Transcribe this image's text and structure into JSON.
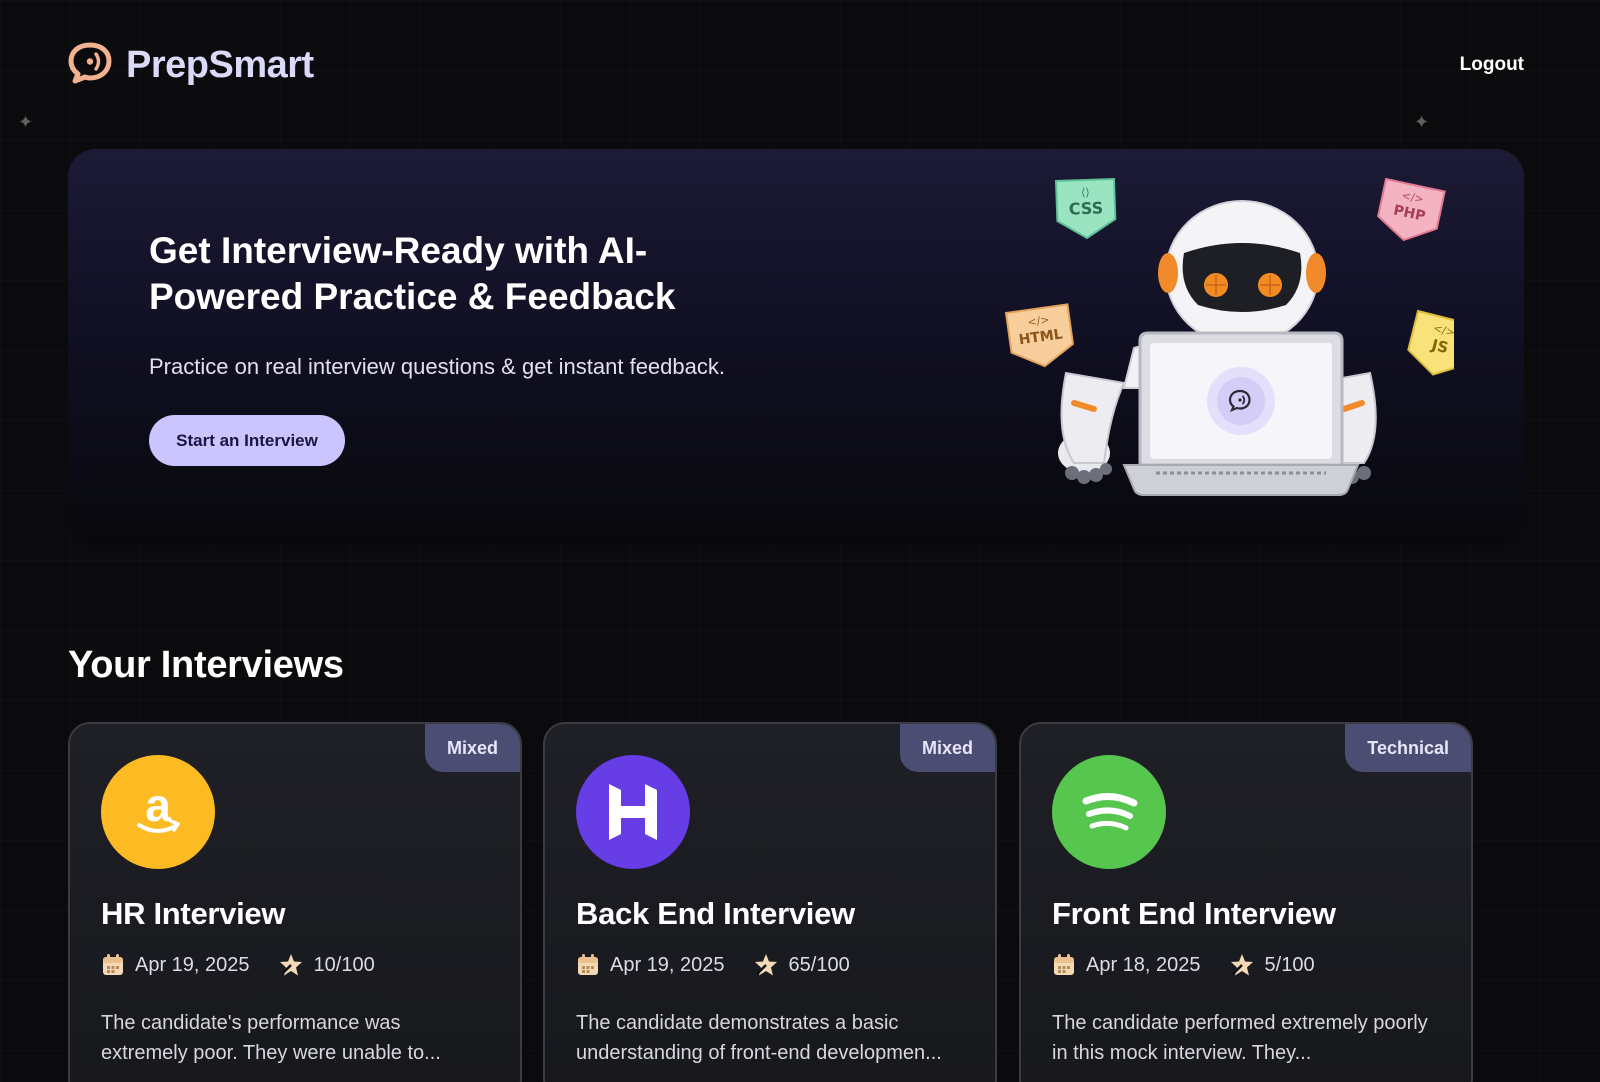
{
  "header": {
    "brand": "PrepSmart",
    "logout_label": "Logout"
  },
  "hero": {
    "title": "Get Interview-Ready with AI-Powered Practice & Feedback",
    "subtitle": "Practice on real interview questions & get instant feedback.",
    "cta_label": "Start an Interview",
    "stickers": [
      "CSS",
      "PHP",
      "HTML",
      "JS"
    ]
  },
  "interviews": {
    "title": "Your Interviews",
    "cards": [
      {
        "role": "HR Interview",
        "type": "Mixed",
        "date": "Apr 19, 2025",
        "score": "10/100",
        "summary": "The candidate's performance was extremely poor. They were unable to...",
        "logo": "amazon-logo",
        "logo_color": "#fcbb22"
      },
      {
        "role": "Back End Interview",
        "type": "Mixed",
        "date": "Apr 19, 2025",
        "score": "65/100",
        "summary": "The candidate demonstrates a basic understanding of front-end developmen...",
        "logo": "hostinger-logo",
        "logo_color": "#673de6"
      },
      {
        "role": "Front End Interview",
        "type": "Technical",
        "date": "Apr 18, 2025",
        "score": "5/100",
        "summary": "The candidate performed extremely poorly in this mock interview. They...",
        "logo": "spotify-logo",
        "logo_color": "#57c64f"
      }
    ]
  },
  "colors": {
    "accent": "#cac5fe",
    "brand_text": "#dad9f7",
    "badge_bg": "#4b4d72",
    "page_bg": "#0b0b0d"
  }
}
